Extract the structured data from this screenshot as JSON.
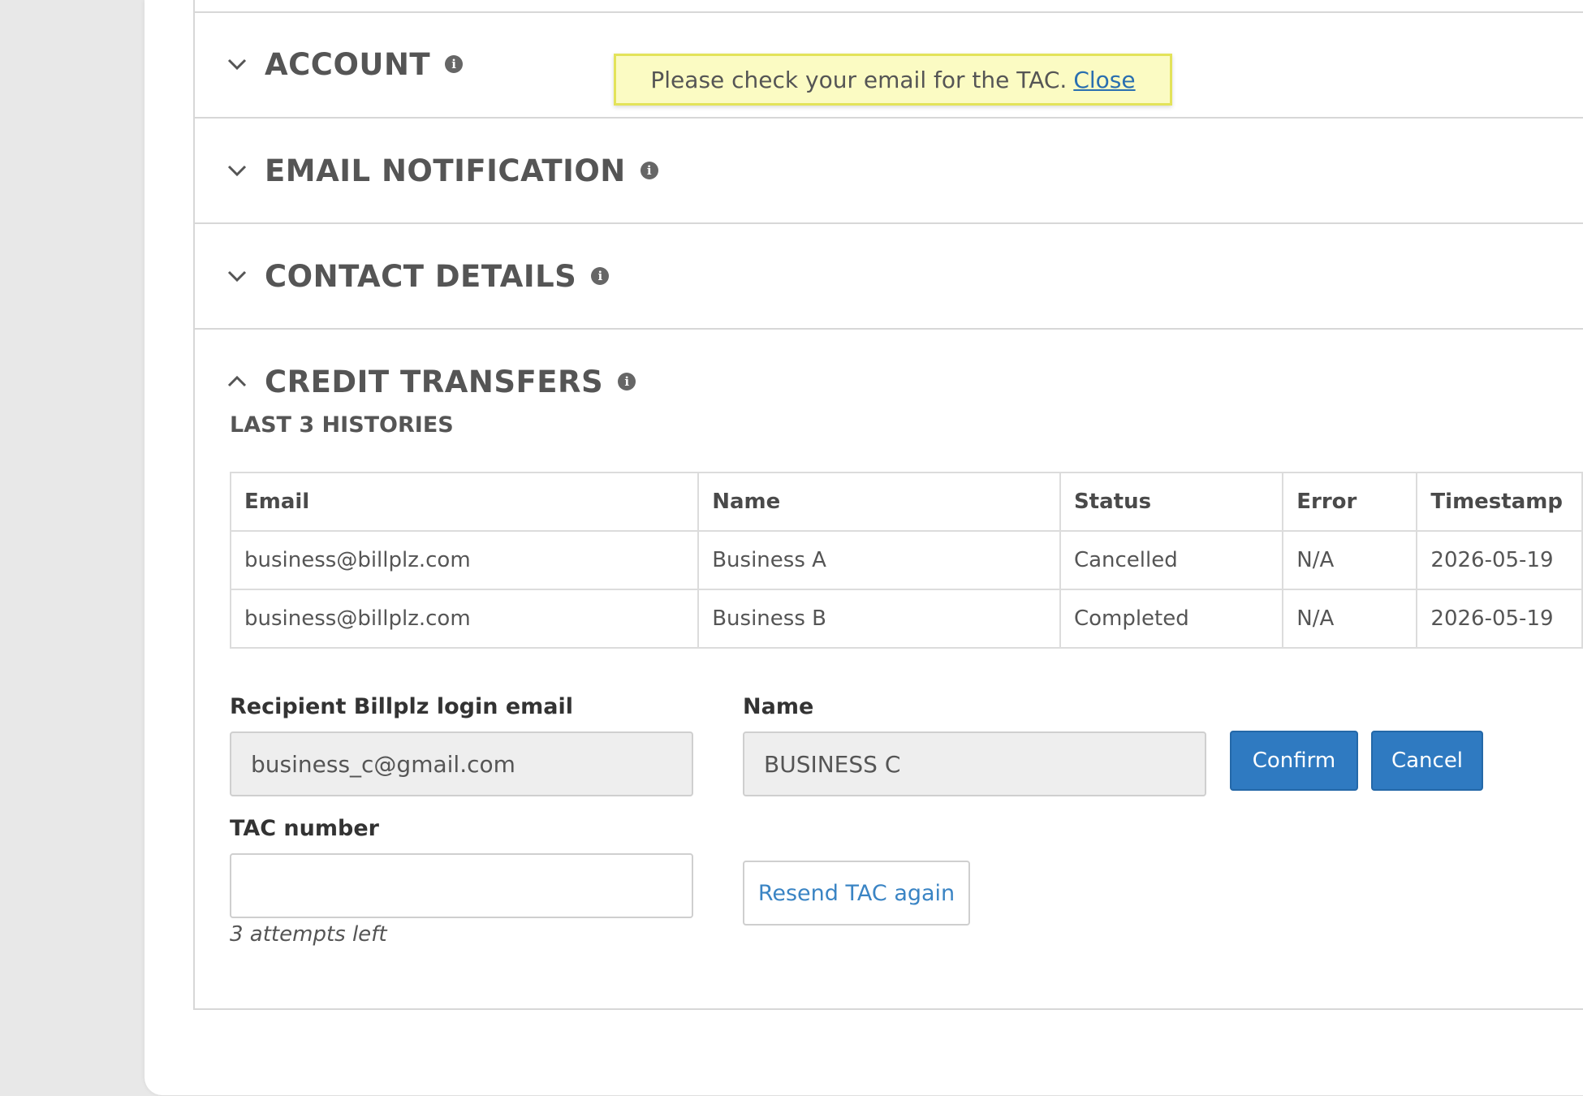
{
  "toast": {
    "message": "Please check your email for the TAC.",
    "close_label": "Close"
  },
  "sections": [
    {
      "title": "ACCOUNT",
      "expanded": false,
      "icon": "chevron-down-icon"
    },
    {
      "title": "EMAIL NOTIFICATION",
      "expanded": false,
      "icon": "chevron-down-icon"
    },
    {
      "title": "CONTACT DETAILS",
      "expanded": false,
      "icon": "chevron-down-icon"
    },
    {
      "title": "CREDIT TRANSFERS",
      "expanded": true,
      "icon": "chevron-up-icon"
    }
  ],
  "info_icon_glyph": "i",
  "credit_transfers": {
    "history_title": "LAST 3 HISTORIES",
    "columns": [
      "Email",
      "Name",
      "Status",
      "Error",
      "Timestamp"
    ],
    "rows": [
      [
        "business@billplz.com",
        "Business A",
        "Cancelled",
        "N/A",
        "2026-05-19"
      ],
      [
        "business@billplz.com",
        "Business B",
        "Completed",
        "N/A",
        "2026-05-19"
      ]
    ],
    "form": {
      "email_label": "Recipient Billplz login email",
      "email_value": "business_c@gmail.com",
      "name_label": "Name",
      "name_value": "BUSINESS C",
      "confirm_label": "Confirm",
      "cancel_label": "Cancel",
      "tac_label": "TAC number",
      "tac_value": "",
      "resend_label": "Resend TAC again",
      "attempts_hint": "3 attempts left"
    }
  },
  "colors": {
    "primary_button": "#2f7ac1",
    "toast_background": "#fbfbc3",
    "toast_border": "#e3e35a",
    "link": "#2a6fb0"
  }
}
